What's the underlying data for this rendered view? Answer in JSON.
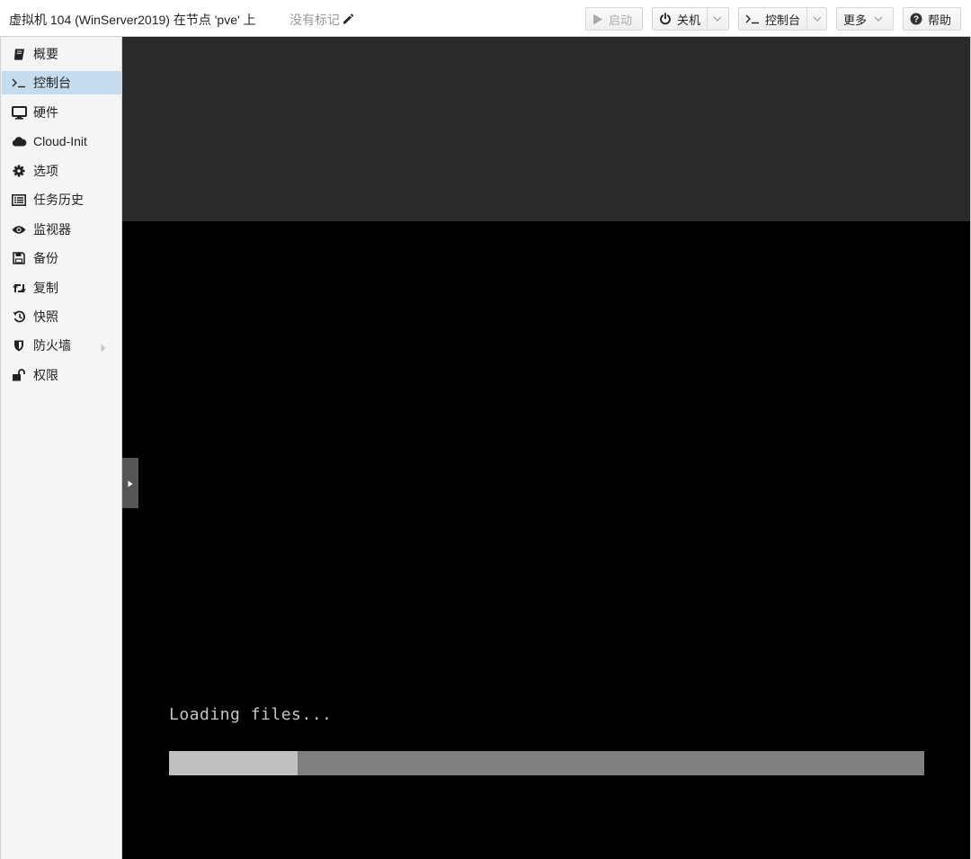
{
  "header": {
    "title": "虚拟机 104 (WinServer2019) 在节点 'pve' 上",
    "tags_label": "没有标记",
    "buttons": {
      "start": "启动",
      "shutdown": "关机",
      "console": "控制台",
      "more": "更多",
      "help": "帮助"
    }
  },
  "sidebar": {
    "items": [
      {
        "label": "概要",
        "icon": "book-icon"
      },
      {
        "label": "控制台",
        "icon": "terminal-icon",
        "active": true
      },
      {
        "label": "硬件",
        "icon": "desktop-icon"
      },
      {
        "label": "Cloud-Init",
        "icon": "cloud-icon"
      },
      {
        "label": "选项",
        "icon": "gear-icon"
      },
      {
        "label": "任务历史",
        "icon": "list-icon"
      },
      {
        "label": "监视器",
        "icon": "eye-icon"
      },
      {
        "label": "备份",
        "icon": "floppy-icon"
      },
      {
        "label": "复制",
        "icon": "retweet-icon"
      },
      {
        "label": "快照",
        "icon": "history-icon"
      },
      {
        "label": "防火墙",
        "icon": "shield-icon",
        "has_submenu": true
      },
      {
        "label": "权限",
        "icon": "unlock-icon"
      }
    ]
  },
  "console": {
    "boot_text": "Loading files...",
    "progress": 0.17
  },
  "colors": {
    "active_item_bg": "#c5dcef",
    "console_bg": "#000000",
    "console_top_bg": "#2a2a2a",
    "progress_track": "#7f7f7f",
    "progress_fill": "#c0c0c0"
  }
}
